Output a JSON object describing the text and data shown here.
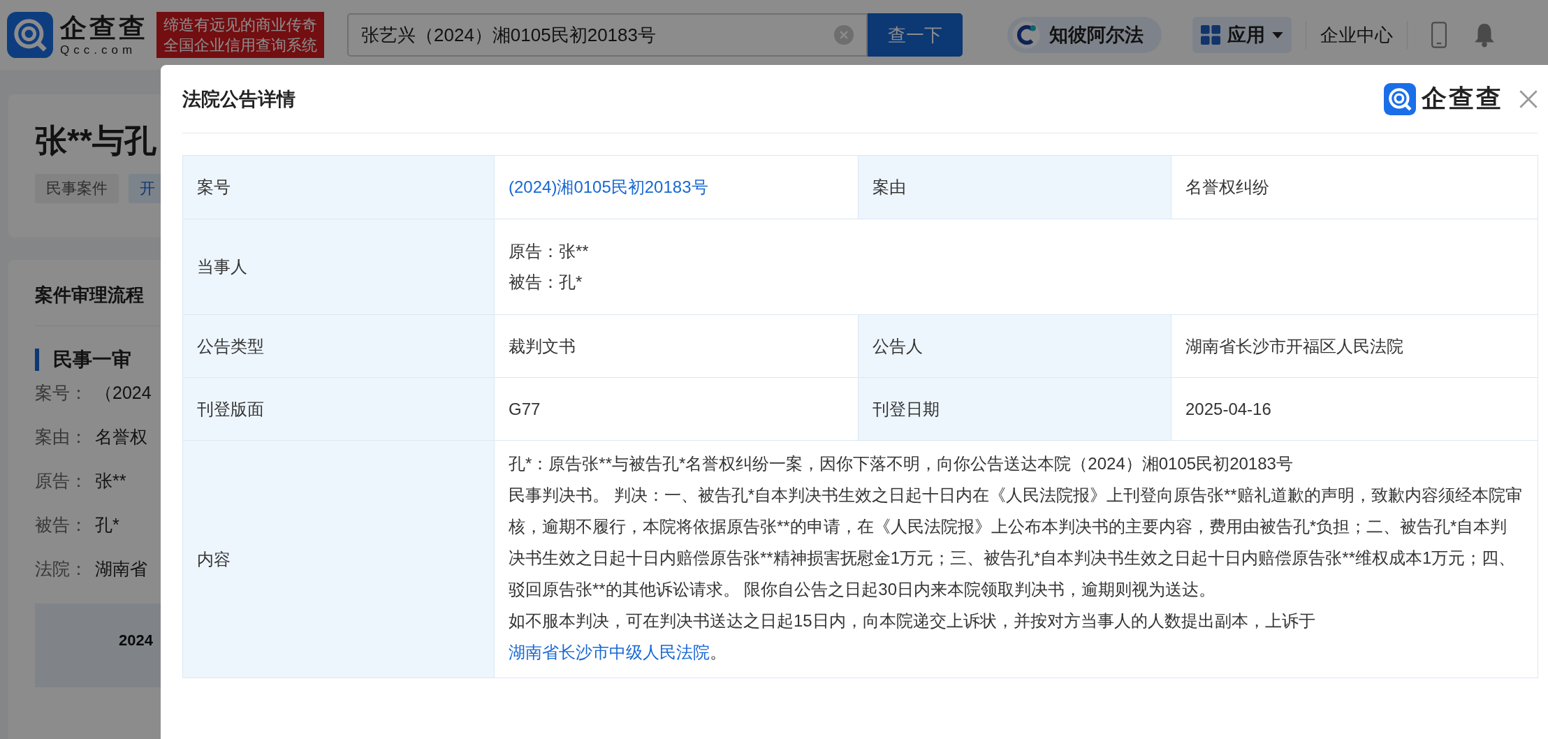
{
  "header": {
    "logo": {
      "name": "企查查",
      "domain": "Qcc.com"
    },
    "slogan": [
      "缔造有远见的商业传奇",
      "全国企业信用查询系统"
    ],
    "search": {
      "value": "张艺兴（2024）湘0105民初20183号",
      "button": "查一下"
    },
    "nav": [
      {
        "kind": "pill",
        "label": "知彼阿尔法"
      },
      {
        "kind": "apps",
        "label": "应用"
      },
      {
        "kind": "link",
        "label": "企业中心"
      }
    ]
  },
  "page": {
    "case_title": "张**与孔",
    "tags": [
      {
        "label": "民事案件",
        "kind": "plain"
      },
      {
        "label": "开",
        "kind": "blue"
      }
    ],
    "process": {
      "title": "案件审理流程",
      "stage": "民事一审",
      "fields": [
        {
          "label": "案号：",
          "value": "（2024"
        },
        {
          "label": "案由：",
          "value": "名誉权"
        },
        {
          "label": "原告：",
          "value": "张**"
        },
        {
          "label": "被告：",
          "value": "孔*"
        },
        {
          "label": "法院：",
          "value": "湖南省"
        }
      ],
      "table_head": "2024"
    }
  },
  "dialog": {
    "title": "法院公告详情",
    "logo": "企查查",
    "rows": [
      {
        "kind": "pair",
        "items": [
          {
            "label": "案号",
            "value": "(2024)湘0105民初20183号",
            "link": true
          },
          {
            "label": "案由",
            "value": "名誉权纠纷",
            "link": false
          }
        ]
      },
      {
        "kind": "lines",
        "label": "当事人",
        "lines": [
          "原告：张**",
          "被告：孔*"
        ]
      },
      {
        "kind": "pair",
        "items": [
          {
            "label": "公告类型",
            "value": "裁判文书",
            "link": false
          },
          {
            "label": "公告人",
            "value": "湖南省长沙市开福区人民法院",
            "link": false
          }
        ]
      },
      {
        "kind": "pair",
        "items": [
          {
            "label": "刊登版面",
            "value": "G77",
            "link": false
          },
          {
            "label": "刊登日期",
            "value": "2025-04-16",
            "link": false
          }
        ]
      },
      {
        "kind": "content",
        "label": "内容",
        "paragraphs": [
          "孔*：原告张**与被告孔*名誉权纠纷一案，因你下落不明，向你公告送达本院（2024）湘0105民初20183号",
          "民事判决书。 判决：一、被告孔*自本判决书生效之日起十日内在《人民法院报》上刊登向原告张**赔礼道歉的声明，致歉内容须经本院审核，逾期不履行，本院将依据原告张**的申请，在《人民法院报》上公布本判决书的主要内容，费用由被告孔*负担；二、被告孔*自本判决书生效之日起十日内赔偿原告张**精神损害抚慰金1万元；三、被告孔*自本判决书生效之日起十日内赔偿原告张**维权成本1万元；四、驳回原告张**的其他诉讼请求。 限你自公告之日起30日内来本院领取判决书，逾期则视为送达。"
        ],
        "appeal": {
          "text": "如不服本判决，可在判决书送达之日起15日内，向本院递交上诉状，并按对方当事人的人数提出副本，上诉于",
          "link": "湖南省长沙市中级人民法院",
          "end": "。"
        }
      }
    ]
  }
}
